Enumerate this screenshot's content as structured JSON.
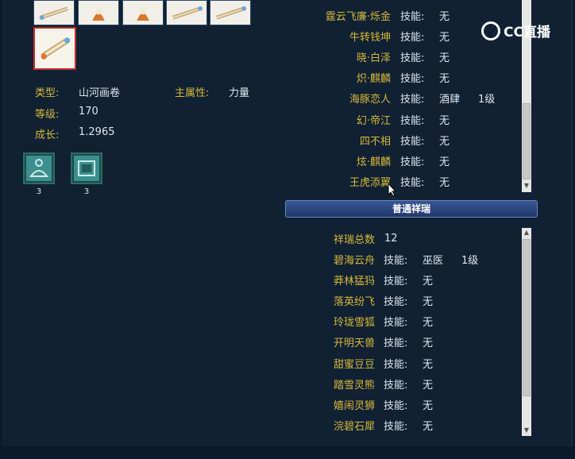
{
  "item": {
    "type_label": "类型:",
    "type_value": "山河画卷",
    "main_attr_label": "主属性:",
    "main_attr_value": "力量",
    "level_label": "等级:",
    "level_value": "170",
    "growth_label": "成长:",
    "growth_value": "1.2965"
  },
  "skills": [
    {
      "icon": "meditation-icon",
      "count": "3"
    },
    {
      "icon": "scroll-frame-icon",
      "count": "3"
    }
  ],
  "top_list": [
    {
      "name": "霆云飞廉·烁金",
      "skill_label": "技能:",
      "skill": "无",
      "level": ""
    },
    {
      "name": "牛转钱坤",
      "skill_label": "技能:",
      "skill": "无",
      "level": ""
    },
    {
      "name": "晓·白泽",
      "skill_label": "技能:",
      "skill": "无",
      "level": ""
    },
    {
      "name": "炽·麒麟",
      "skill_label": "技能:",
      "skill": "无",
      "level": ""
    },
    {
      "name": "海豚恋人",
      "skill_label": "技能:",
      "skill": "酒肆",
      "level": "1级"
    },
    {
      "name": "幻·帝江",
      "skill_label": "技能:",
      "skill": "无",
      "level": ""
    },
    {
      "name": "四不相",
      "skill_label": "技能:",
      "skill": "无",
      "level": ""
    },
    {
      "name": "炫·麒麟",
      "skill_label": "技能:",
      "skill": "无",
      "level": ""
    },
    {
      "name": "王虎添翼",
      "skill_label": "技能:",
      "skill": "无",
      "level": ""
    }
  ],
  "section_title": "普通祥瑞",
  "bottom": {
    "total_label": "祥瑞总数",
    "total_value": "12",
    "list": [
      {
        "name": "碧海云舟",
        "skill_label": "技能:",
        "skill": "巫医",
        "level": "1级"
      },
      {
        "name": "莽林猛犸",
        "skill_label": "技能:",
        "skill": "无",
        "level": ""
      },
      {
        "name": "落英纷飞",
        "skill_label": "技能:",
        "skill": "无",
        "level": ""
      },
      {
        "name": "玲珑雪狐",
        "skill_label": "技能:",
        "skill": "无",
        "level": ""
      },
      {
        "name": "开明天兽",
        "skill_label": "技能:",
        "skill": "无",
        "level": ""
      },
      {
        "name": "甜蜜豆豆",
        "skill_label": "技能:",
        "skill": "无",
        "level": ""
      },
      {
        "name": "踏雪灵熊",
        "skill_label": "技能:",
        "skill": "无",
        "level": ""
      },
      {
        "name": "嬉闹灵狮",
        "skill_label": "技能:",
        "skill": "无",
        "level": ""
      },
      {
        "name": "浣碧石犀",
        "skill_label": "技能:",
        "skill": "无",
        "level": ""
      }
    ]
  },
  "watermark": "CC直播"
}
